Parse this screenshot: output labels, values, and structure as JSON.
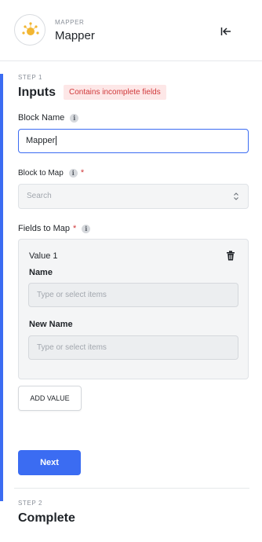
{
  "header": {
    "kicker": "MAPPER",
    "title": "Mapper",
    "icon": "mapper-icon",
    "accent": "#f2b632"
  },
  "step1": {
    "label": "STEP 1",
    "title": "Inputs",
    "badge": "Contains incomplete fields",
    "block_name": {
      "label": "Block Name",
      "value": "Mapper"
    },
    "block_to_map": {
      "label": "Block to Map",
      "required_mark": "*",
      "placeholder": "Search"
    },
    "fields_to_map": {
      "label": "Fields to Map",
      "required_mark": "*",
      "values": [
        {
          "title": "Value 1",
          "name_label": "Name",
          "name_placeholder": "Type or select items",
          "new_name_label": "New Name",
          "new_name_placeholder": "Type or select items"
        }
      ],
      "add_value_label": "ADD VALUE"
    },
    "next_label": "Next"
  },
  "step2": {
    "label": "STEP 2",
    "title": "Complete"
  },
  "colors": {
    "primary": "#3b6cf2",
    "warning_bg": "#fde7e7",
    "warning_text": "#d0393b"
  }
}
